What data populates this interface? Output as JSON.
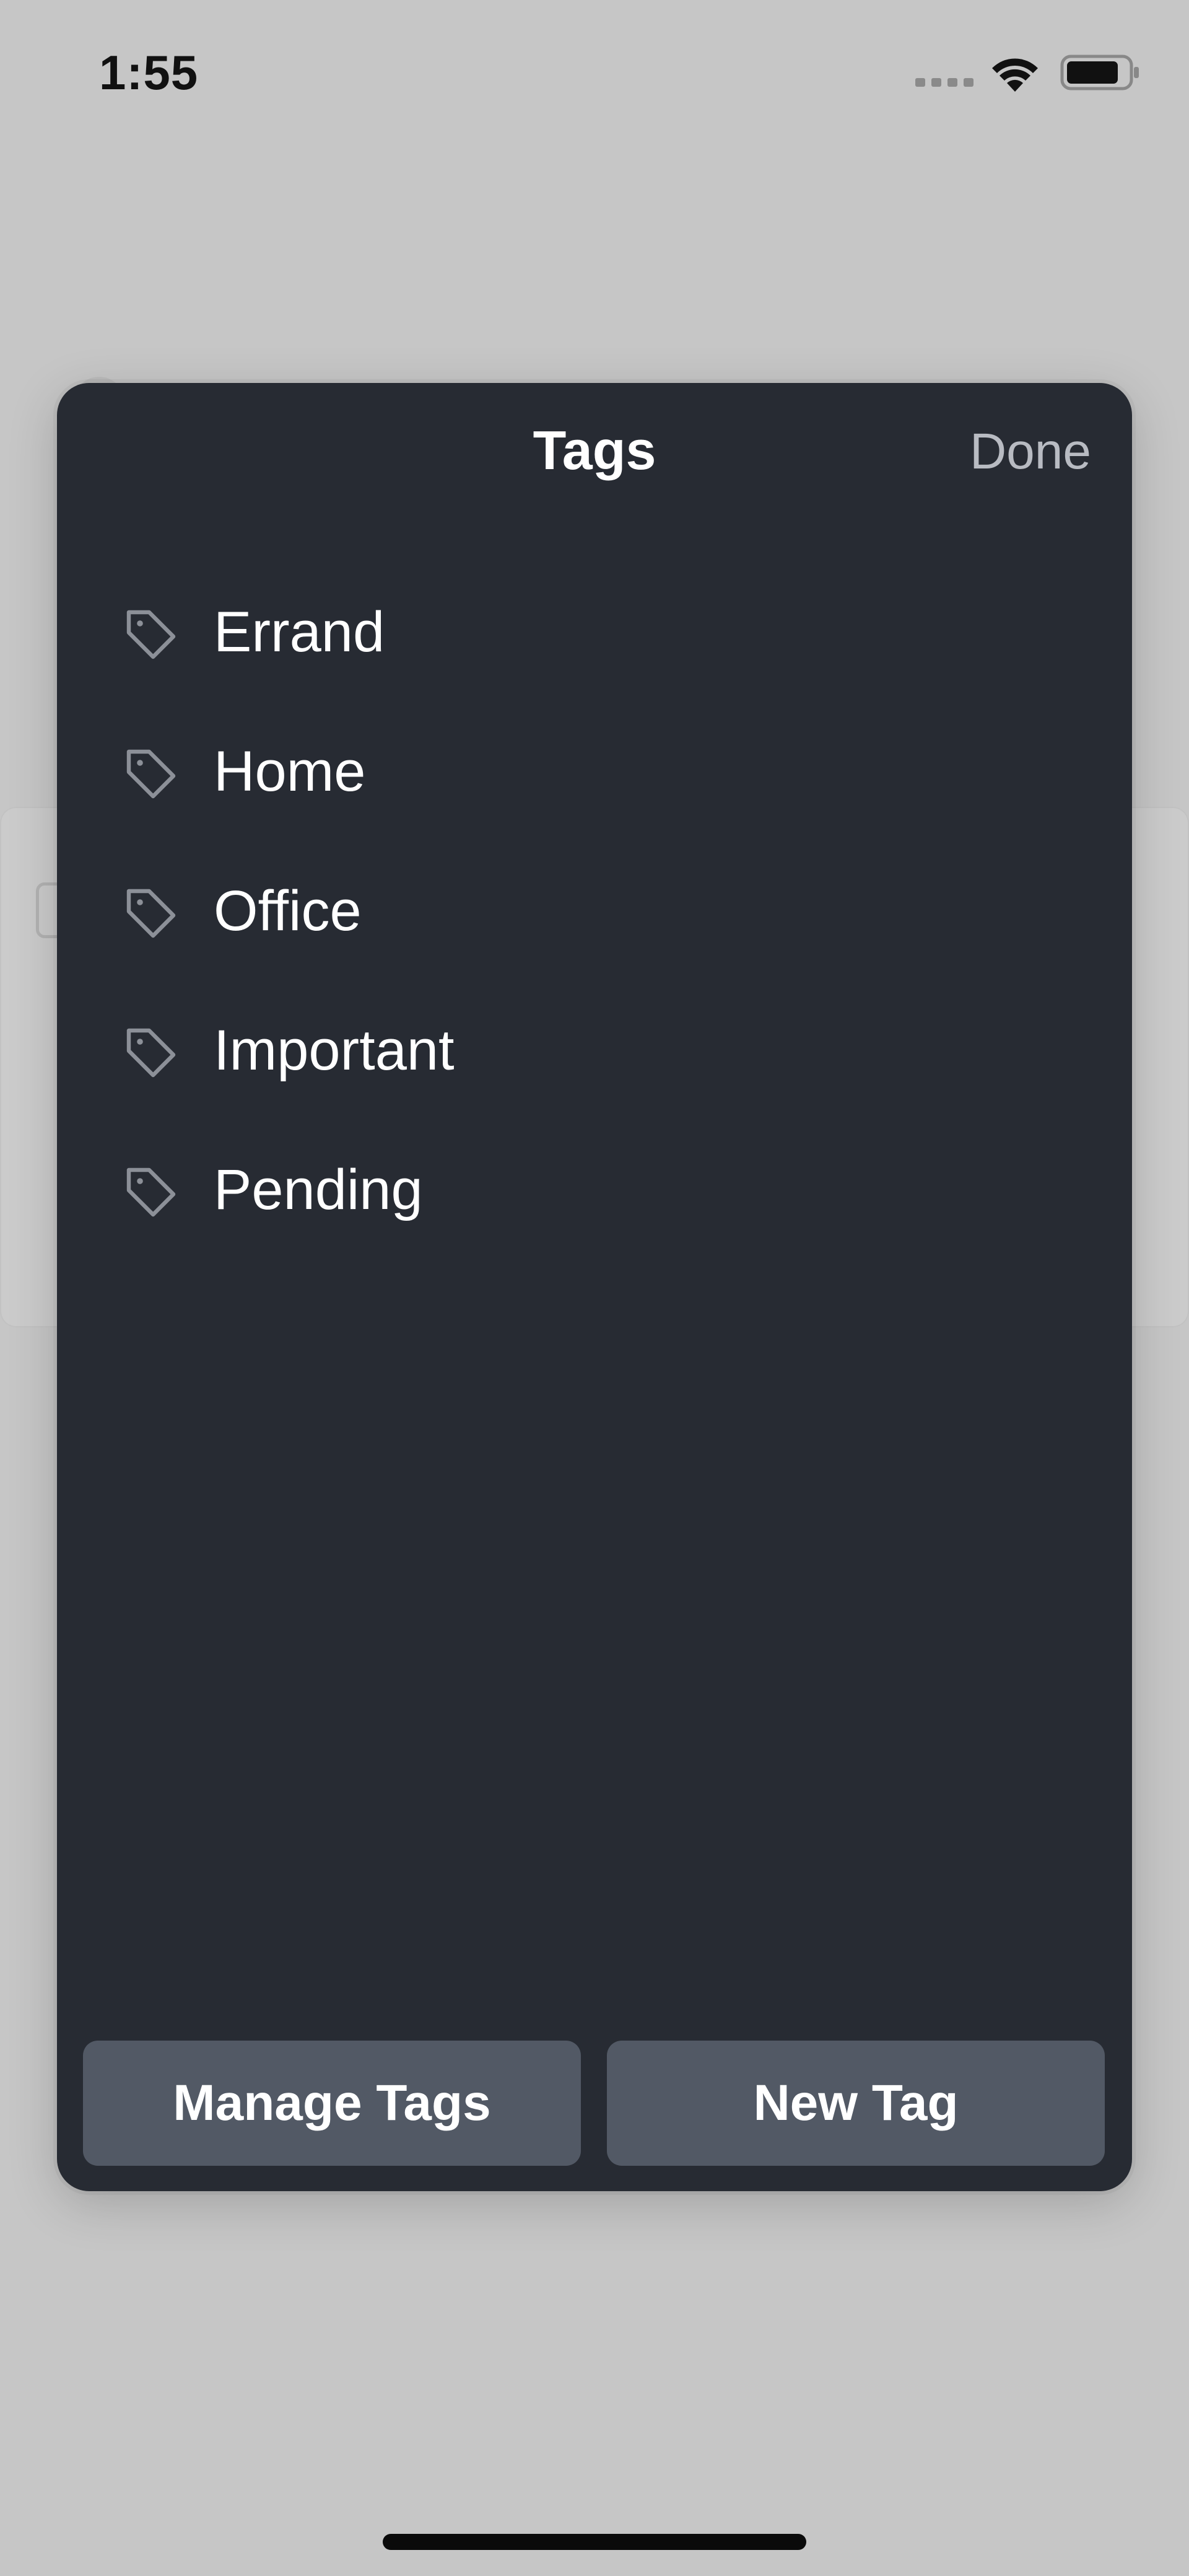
{
  "status_bar": {
    "time": "1:55"
  },
  "sheet": {
    "title": "Tags",
    "done_label": "Done",
    "tags": [
      {
        "label": "Errand",
        "icon": "tag-icon"
      },
      {
        "label": "Home",
        "icon": "tag-icon"
      },
      {
        "label": "Office",
        "icon": "tag-icon"
      },
      {
        "label": "Important",
        "icon": "tag-icon"
      },
      {
        "label": "Pending",
        "icon": "tag-icon"
      }
    ],
    "buttons": {
      "manage_label": "Manage Tags",
      "new_label": "New Tag"
    }
  },
  "colors": {
    "sheet_background": "#272b33",
    "button_background": "#525965",
    "page_background": "#c6c6c6",
    "done_text": "#b8bbc2"
  }
}
